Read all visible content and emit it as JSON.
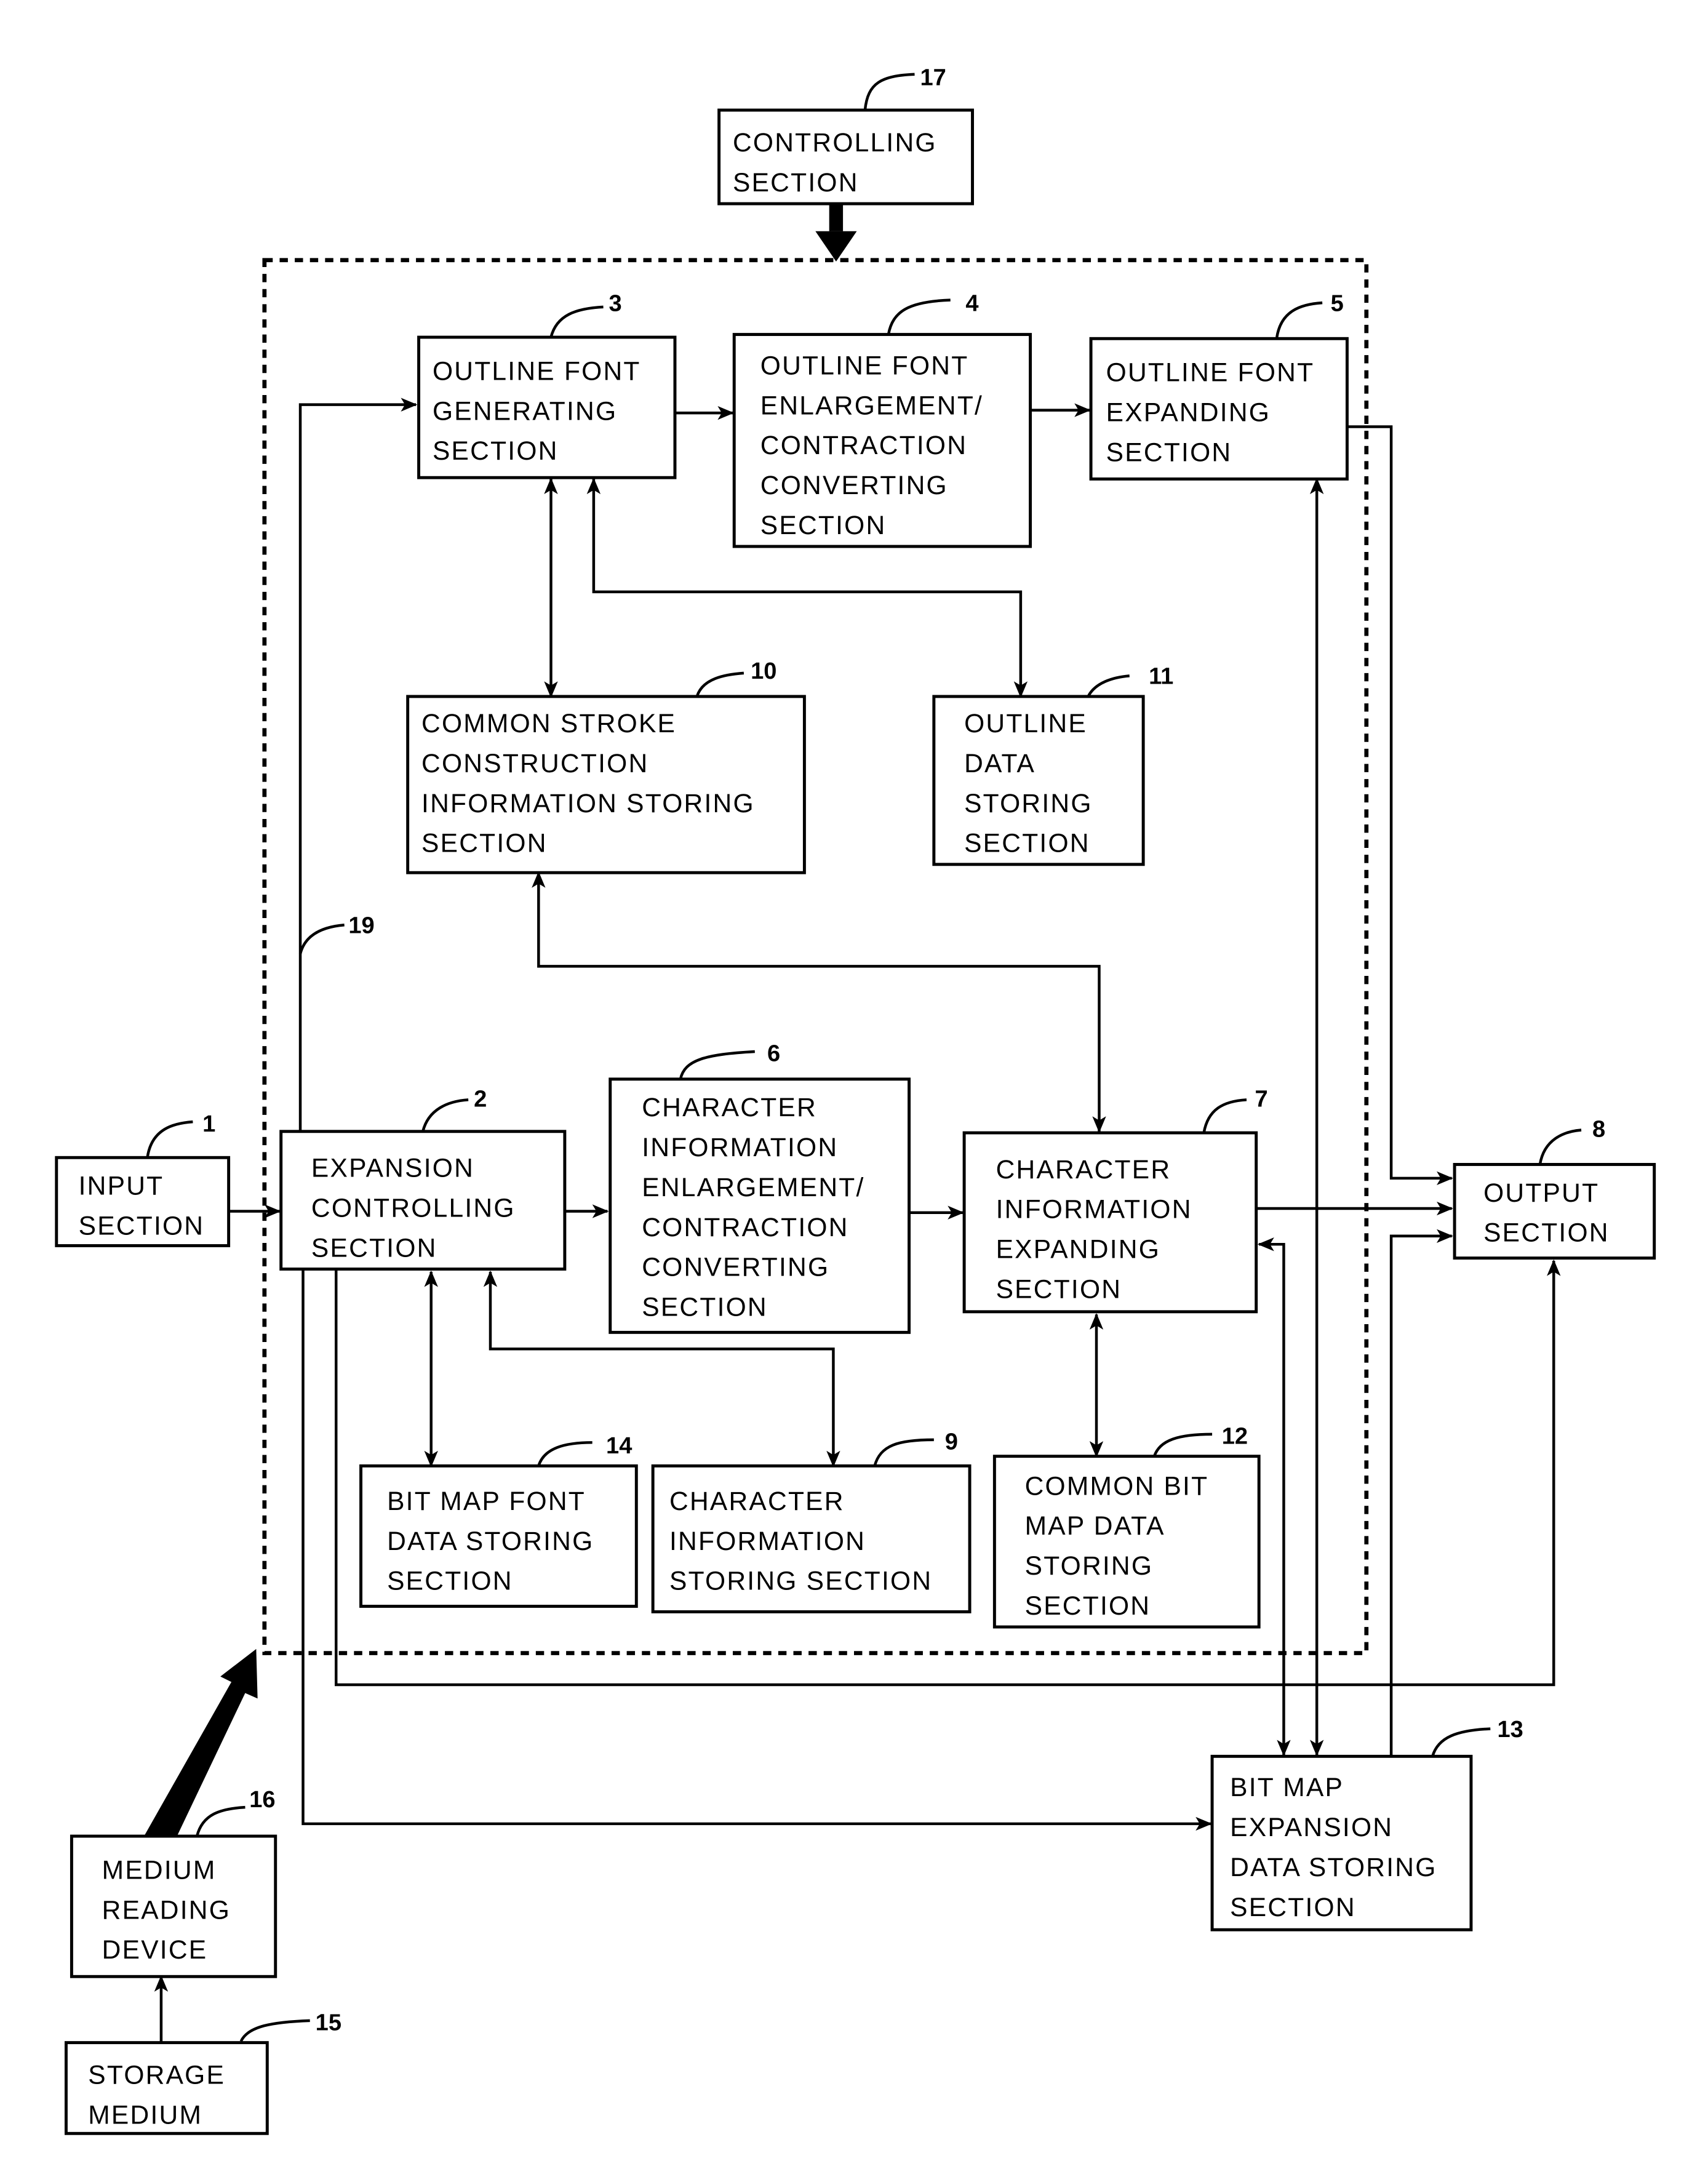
{
  "figure": {
    "blocks": [
      {
        "id": "17",
        "ref": "17",
        "lines": [
          "CONTROLLING",
          "SECTION"
        ]
      },
      {
        "id": "3",
        "ref": "3",
        "lines": [
          "OUTLINE FONT",
          "GENERATING",
          "SECTION"
        ]
      },
      {
        "id": "4",
        "ref": "4",
        "lines": [
          "OUTLINE FONT",
          "ENLARGEMENT/",
          "CONTRACTION",
          "CONVERTING",
          "SECTION"
        ]
      },
      {
        "id": "5",
        "ref": "5",
        "lines": [
          "OUTLINE FONT",
          "EXPANDING",
          "SECTION"
        ]
      },
      {
        "id": "10",
        "ref": "10",
        "lines": [
          "COMMON STROKE",
          "CONSTRUCTION",
          "INFORMATION STORING",
          "SECTION"
        ]
      },
      {
        "id": "11",
        "ref": "11",
        "lines": [
          "OUTLINE",
          "DATA",
          "STORING",
          "SECTION"
        ]
      },
      {
        "id": "1",
        "ref": "1",
        "lines": [
          "INPUT",
          "SECTION"
        ]
      },
      {
        "id": "2",
        "ref": "2",
        "lines": [
          "EXPANSION",
          "CONTROLLING",
          "SECTION"
        ]
      },
      {
        "id": "6",
        "ref": "6",
        "lines": [
          "CHARACTER",
          "INFORMATION",
          "ENLARGEMENT/",
          "CONTRACTION",
          "CONVERTING",
          "SECTION"
        ]
      },
      {
        "id": "7",
        "ref": "7",
        "lines": [
          "CHARACTER",
          "INFORMATION",
          "EXPANDING",
          "SECTION"
        ]
      },
      {
        "id": "8",
        "ref": "8",
        "lines": [
          "OUTPUT",
          "SECTION"
        ]
      },
      {
        "id": "14",
        "ref": "14",
        "lines": [
          "BIT MAP FONT",
          "DATA STORING",
          "SECTION"
        ]
      },
      {
        "id": "9",
        "ref": "9",
        "lines": [
          "CHARACTER",
          "INFORMATION",
          "STORING SECTION"
        ]
      },
      {
        "id": "12",
        "ref": "12",
        "lines": [
          "COMMON BIT",
          "MAP DATA",
          "STORING",
          "SECTION"
        ]
      },
      {
        "id": "13",
        "ref": "13",
        "lines": [
          "BIT MAP",
          "EXPANSION",
          "DATA STORING",
          "SECTION"
        ]
      },
      {
        "id": "16",
        "ref": "16",
        "lines": [
          "MEDIUM",
          "READING",
          "DEVICE"
        ]
      },
      {
        "id": "15",
        "ref": "15",
        "lines": [
          "STORAGE",
          "MEDIUM"
        ]
      }
    ],
    "line_refs": [
      {
        "id": "19",
        "ref": "19"
      }
    ]
  }
}
